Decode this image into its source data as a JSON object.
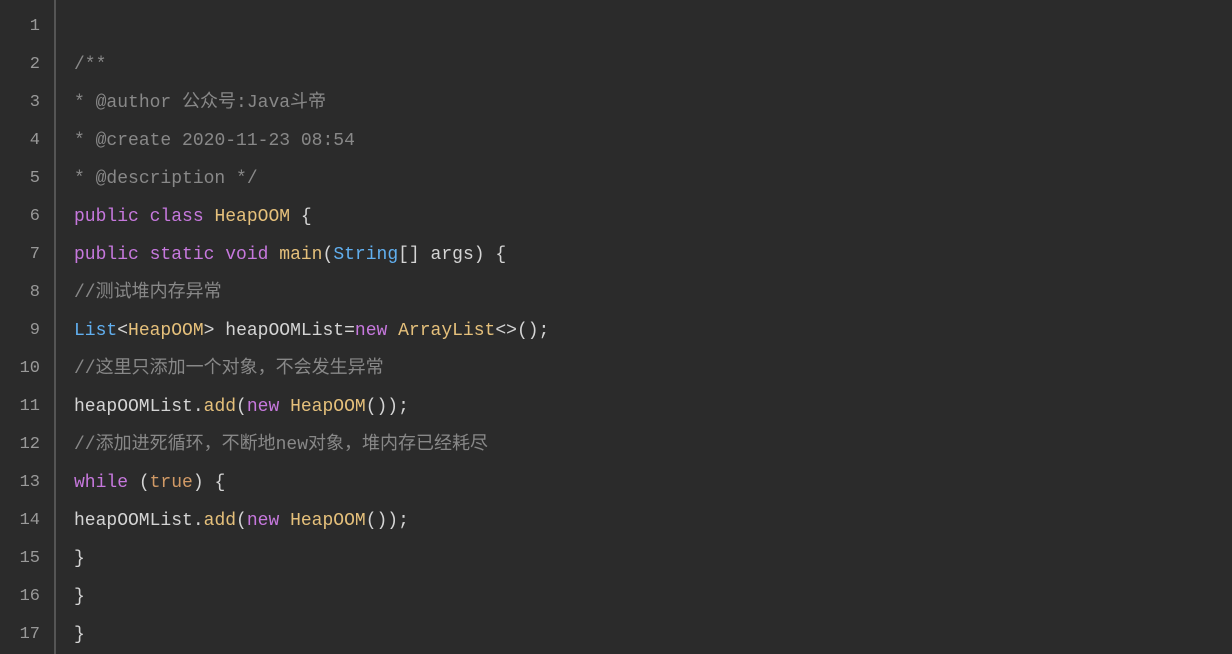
{
  "gutter": {
    "lines": [
      "1",
      "2",
      "3",
      "4",
      "5",
      "6",
      "7",
      "8",
      "9",
      "10",
      "11",
      "12",
      "13",
      "14",
      "15",
      "16",
      "17"
    ]
  },
  "code": {
    "l1": "",
    "l2_open": "/**",
    "l3_star": "* ",
    "l3_tag": "@author",
    "l3_text": " 公众号:Java斗帝",
    "l4_star": "* ",
    "l4_tag": "@create",
    "l4_text": " 2020-11-23 08:54",
    "l5_star": "* ",
    "l5_tag": "@description",
    "l5_close": " */",
    "l6_kw_public": "public",
    "l6_kw_class": "class",
    "l6_name": "HeapOOM",
    "l6_brace": "{",
    "l7_kw_public": "public",
    "l7_kw_static": "static",
    "l7_kw_void": "void",
    "l7_method": "main",
    "l7_lp": "(",
    "l7_string": "String",
    "l7_brackets": "[]",
    "l7_args": " args",
    "l7_rp": ")",
    "l7_brace": " {",
    "l8_comment": "//测试堆内存异常",
    "l9_list": "List",
    "l9_lt": "<",
    "l9_heap": "HeapOOM",
    "l9_gt": ">",
    "l9_var": " heapOOMList",
    "l9_eq": "=",
    "l9_new": "new",
    "l9_arraylist": " ArrayList",
    "l9_diamond": "<>",
    "l9_call": "();",
    "l10_comment": "//这里只添加一个对象，不会发生异常",
    "l11_var": "heapOOMList",
    "l11_dot": ".",
    "l11_add": "add",
    "l11_lp": "(",
    "l11_new": "new",
    "l11_heap": " HeapOOM",
    "l11_rp": "());",
    "l12_comment_a": "//添加进死循环，不断地",
    "l12_new_word": "new",
    "l12_comment_b": "对象，堆内存已经耗尽",
    "l13_while": "while",
    "l13_lp": " (",
    "l13_true": "true",
    "l13_rp": ") {",
    "l14_var": "heapOOMList",
    "l14_dot": ".",
    "l14_add": "add",
    "l14_lp": "(",
    "l14_new": "new",
    "l14_heap": " HeapOOM",
    "l14_rp": "());",
    "l15_brace": "}",
    "l16_brace": "}",
    "l17_brace": "}"
  }
}
